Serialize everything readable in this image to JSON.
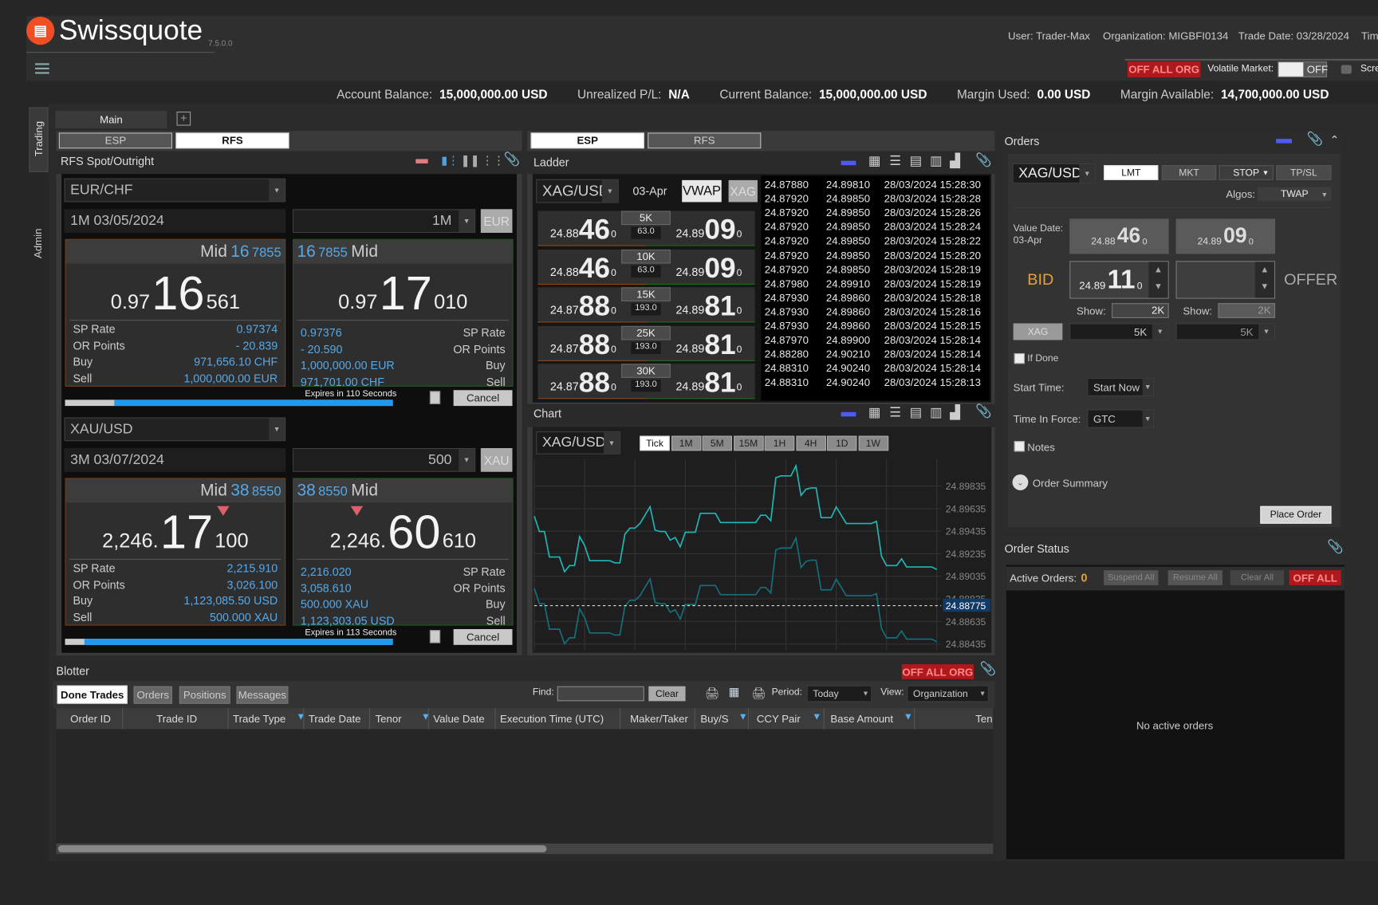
{
  "header": {
    "brand": "Swissquote",
    "version": "7.5.0.0",
    "user": "User: Trader-Max",
    "organization": "Organization: MIGBFI0134",
    "trade_date": "Trade Date: 03/28/2024",
    "time_label": "Tim",
    "off_all_org": "OFF ALL ORG",
    "volatile_label": "Volatile Market:",
    "volatile_state": "OFF",
    "screen_lock": "Scre"
  },
  "account": [
    {
      "label": "Account Balance:",
      "value": "15,000,000.00 USD"
    },
    {
      "label": "Unrealized P/L:",
      "value": "N/A"
    },
    {
      "label": "Current Balance:",
      "value": "15,000,000.00 USD"
    },
    {
      "label": "Margin Used:",
      "value": "0.00 USD"
    },
    {
      "label": "Margin Available:",
      "value": "14,700,000.00 USD"
    }
  ],
  "side_tabs": [
    "Trading",
    "Admin"
  ],
  "workspace_tab": "Main",
  "rfs": {
    "tabs": [
      "ESP",
      "RFS"
    ],
    "active_tab": "RFS",
    "title": "RFS Spot/Outright",
    "cancel_label": "Cancel",
    "blocks": [
      {
        "pair": "EUR/CHF",
        "tenor": "1M 03/05/2024",
        "amount": "1M",
        "currency": "EUR",
        "expires": "Expires in 110 Seconds",
        "progress_pct": 85,
        "bid": {
          "mid_label": "Mid",
          "mid_big": "16",
          "mid_small": "7855",
          "pre": "0.97",
          "big": "16",
          "post": "561",
          "arrow_down": false,
          "rows": [
            {
              "label": "SP Rate",
              "value": "0.97374"
            },
            {
              "label": "OR Points",
              "value": "- 20.839"
            },
            {
              "label": "Buy",
              "value": "971,656.10 CHF"
            },
            {
              "label": "Sell",
              "value": "1,000,000.00 EUR"
            }
          ]
        },
        "offer": {
          "mid_label": "Mid",
          "mid_big": "16",
          "mid_small": "7855",
          "pre": "0.97",
          "big": "17",
          "post": "010",
          "arrow_down": false,
          "rows": [
            {
              "label": "SP Rate",
              "value": "0.97376"
            },
            {
              "label": "OR Points",
              "value": "- 20.590"
            },
            {
              "label": "Buy",
              "value": "1,000,000.00 EUR"
            },
            {
              "label": "Sell",
              "value": "971,701.00 CHF"
            }
          ]
        }
      },
      {
        "pair": "XAU/USD",
        "tenor": "3M 03/07/2024",
        "amount": "500",
        "currency": "XAU",
        "expires": "Expires in 113 Seconds",
        "progress_pct": 94,
        "bid": {
          "mid_label": "Mid",
          "mid_big": "38",
          "mid_small": "8550",
          "pre": "2,246.",
          "big": "17",
          "post": "100",
          "arrow_down": true,
          "rows": [
            {
              "label": "SP Rate",
              "value": "2,215.910"
            },
            {
              "label": "OR Points",
              "value": "3,026.100"
            },
            {
              "label": "Buy",
              "value": "1,123,085.50 USD"
            },
            {
              "label": "Sell",
              "value": "500.000 XAU"
            }
          ]
        },
        "offer": {
          "mid_label": "Mid",
          "mid_big": "38",
          "mid_small": "8550",
          "pre": "2,246.",
          "big": "60",
          "post": "610",
          "arrow_down": true,
          "rows": [
            {
              "label": "SP Rate",
              "value": "2,216.020"
            },
            {
              "label": "OR Points",
              "value": "3,058.610"
            },
            {
              "label": "Buy",
              "value": "500.000 XAU"
            },
            {
              "label": "Sell",
              "value": "1,123,303.05 USD"
            }
          ]
        }
      }
    ]
  },
  "esp": {
    "tabs": [
      "ESP",
      "RFS"
    ],
    "active_tab": "ESP",
    "ladder": {
      "title": "Ladder",
      "pair": "XAG/USD",
      "value_date": "03-Apr",
      "vwap_label": "VWAP",
      "ccy_label": "XAG",
      "rows": [
        {
          "size": "5K",
          "spread": "63.0",
          "bid": [
            "24.88",
            "46",
            "0"
          ],
          "ask": [
            "24.89",
            "09",
            "0"
          ]
        },
        {
          "size": "10K",
          "spread": "63.0",
          "bid": [
            "24.88",
            "46",
            "0"
          ],
          "ask": [
            "24.89",
            "09",
            "0"
          ]
        },
        {
          "size": "15K",
          "spread": "193.0",
          "bid": [
            "24.87",
            "88",
            "0"
          ],
          "ask": [
            "24.89",
            "81",
            "0"
          ]
        },
        {
          "size": "25K",
          "spread": "193.0",
          "bid": [
            "24.87",
            "88",
            "0"
          ],
          "ask": [
            "24.89",
            "81",
            "0"
          ]
        },
        {
          "size": "30K",
          "spread": "193.0",
          "bid": [
            "24.87",
            "88",
            "0"
          ],
          "ask": [
            "24.89",
            "81",
            "0"
          ]
        }
      ],
      "ticks": [
        [
          "24.87880",
          "24.89810",
          "28/03/2024 15:28:30"
        ],
        [
          "24.87920",
          "24.89850",
          "28/03/2024 15:28:28"
        ],
        [
          "24.87920",
          "24.89850",
          "28/03/2024 15:28:26"
        ],
        [
          "24.87920",
          "24.89850",
          "28/03/2024 15:28:24"
        ],
        [
          "24.87920",
          "24.89850",
          "28/03/2024 15:28:22"
        ],
        [
          "24.87920",
          "24.89850",
          "28/03/2024 15:28:20"
        ],
        [
          "24.87920",
          "24.89850",
          "28/03/2024 15:28:19"
        ],
        [
          "24.87980",
          "24.89910",
          "28/03/2024 15:28:19"
        ],
        [
          "24.87930",
          "24.89860",
          "28/03/2024 15:28:18"
        ],
        [
          "24.87930",
          "24.89860",
          "28/03/2024 15:28:16"
        ],
        [
          "24.87930",
          "24.89860",
          "28/03/2024 15:28:15"
        ],
        [
          "24.87970",
          "24.89900",
          "28/03/2024 15:28:14"
        ],
        [
          "24.88280",
          "24.90210",
          "28/03/2024 15:28:14"
        ],
        [
          "24.88310",
          "24.90240",
          "28/03/2024 15:28:14"
        ],
        [
          "24.88310",
          "24.90240",
          "28/03/2024 15:28:13"
        ]
      ]
    },
    "chart": {
      "title": "Chart",
      "pair": "XAG/USD",
      "timeframes": [
        "Tick",
        "1M",
        "5M",
        "15M",
        "1H",
        "4H",
        "1D",
        "1W"
      ],
      "active_timeframe": "Tick"
    }
  },
  "chart_data": {
    "type": "line",
    "ylim": [
      24.8838,
      24.9007
    ],
    "xlim": [
      0,
      80
    ],
    "y_ticks": [
      "24.89835",
      "24.89635",
      "24.89435",
      "24.89235",
      "24.89035",
      "24.88835",
      "24.88635",
      "24.88435"
    ],
    "current_price": "24.88775",
    "grid": true,
    "colors": {
      "ask": "#1fb8b8",
      "bid": "#13707c",
      "current": "#dddddd"
    },
    "x": [
      0,
      1,
      2,
      3,
      5,
      6,
      7,
      8,
      9,
      10,
      11,
      15,
      16,
      17,
      18,
      19,
      20,
      21,
      23,
      24,
      25,
      26,
      27,
      28,
      29,
      30,
      32,
      33,
      36,
      37,
      44,
      45,
      46,
      47,
      48,
      49,
      51,
      52,
      53,
      54,
      55,
      56,
      57,
      59,
      60,
      62,
      67,
      68,
      69,
      70,
      72,
      73,
      74,
      79,
      80
    ],
    "series": [
      {
        "values": [
          24.89569,
          24.89432,
          24.89432,
          24.89206,
          24.89206,
          24.89076,
          24.8913,
          24.8913,
          24.89387,
          24.89308,
          24.89173,
          24.89173,
          24.89154,
          24.89154,
          24.89408,
          24.89462,
          24.89462,
          24.89503,
          24.89652,
          24.89444,
          24.89432,
          24.89432,
          24.89356,
          24.89379,
          24.89296,
          24.89425,
          24.89425,
          24.89593,
          24.89593,
          24.89512,
          24.89512,
          24.89576,
          24.89576,
          24.89527,
          24.89909,
          24.89925,
          24.89925,
          24.90015,
          24.89752,
          24.89807,
          24.89818,
          24.89818,
          24.89555,
          24.89555,
          24.8965,
          24.89503,
          24.89503,
          24.89522,
          24.89213,
          24.8913,
          24.8913,
          24.8919,
          24.89118,
          24.89118,
          24.89095
        ]
      },
      {
        "values": [
          24.88929,
          24.88792,
          24.88792,
          24.88566,
          24.88566,
          24.88436,
          24.8849,
          24.8849,
          24.88747,
          24.88668,
          24.88533,
          24.88533,
          24.88514,
          24.88514,
          24.88768,
          24.88822,
          24.88822,
          24.88863,
          24.89012,
          24.88804,
          24.88792,
          24.88792,
          24.88716,
          24.88739,
          24.88656,
          24.88785,
          24.88785,
          24.88953,
          24.88953,
          24.88872,
          24.88872,
          24.88936,
          24.88936,
          24.88887,
          24.89269,
          24.89285,
          24.89285,
          24.89375,
          24.89112,
          24.89167,
          24.89178,
          24.89178,
          24.88915,
          24.88915,
          24.8901,
          24.88863,
          24.88863,
          24.88882,
          24.88573,
          24.8849,
          24.8849,
          24.8855,
          24.88478,
          24.88478,
          24.88455
        ]
      }
    ]
  },
  "orders": {
    "title": "Orders",
    "pair": "XAG/USD",
    "types": [
      "LMT",
      "MKT",
      "STOP",
      "TP/SL"
    ],
    "active_type": "LMT",
    "algos_label": "Algos:",
    "algo": "TWAP",
    "value_date_label": "Value Date:",
    "value_date": "03-Apr",
    "bid_rate": [
      "24.88",
      "46",
      "0"
    ],
    "offer_rate": [
      "24.89",
      "09",
      "0"
    ],
    "bid_label": "BID",
    "offer_label": "OFFER",
    "bid_price": [
      "24.89",
      "11",
      "0"
    ],
    "offer_price": "",
    "show_label": "Show:",
    "bid_show": "2K",
    "offer_show": "2K",
    "ccy": "XAG",
    "bid_amount": "5K",
    "offer_amount": "5K",
    "if_done": "If Done",
    "start_time_label": "Start Time:",
    "start_time": "Start Now",
    "tif_label": "Time In Force:",
    "tif": "GTC",
    "notes": "Notes",
    "summary": "Order Summary",
    "place": "Place Order"
  },
  "order_status": {
    "title": "Order Status",
    "active_label": "Active Orders:",
    "active_count": "0",
    "buttons": [
      "Suspend All",
      "Resume All",
      "Clear All"
    ],
    "off_all": "OFF ALL",
    "empty": "No active orders"
  },
  "blotter": {
    "title": "Blotter",
    "off_all_org": "OFF ALL ORG",
    "tabs": [
      "Done Trades",
      "Orders",
      "Positions",
      "Messages"
    ],
    "active_tab": "Done Trades",
    "find_label": "Find:",
    "find_value": "",
    "clear": "Clear",
    "period_label": "Period:",
    "period": "Today",
    "view_label": "View:",
    "view": "Organization",
    "columns": [
      "Order ID",
      "Trade ID",
      "Trade Type",
      "Trade Date",
      "Tenor",
      "Value Date",
      "Execution Time (UTC)",
      "Maker/Taker",
      "Buy/S",
      "CCY Pair",
      "Base Amount",
      "Ten"
    ]
  }
}
